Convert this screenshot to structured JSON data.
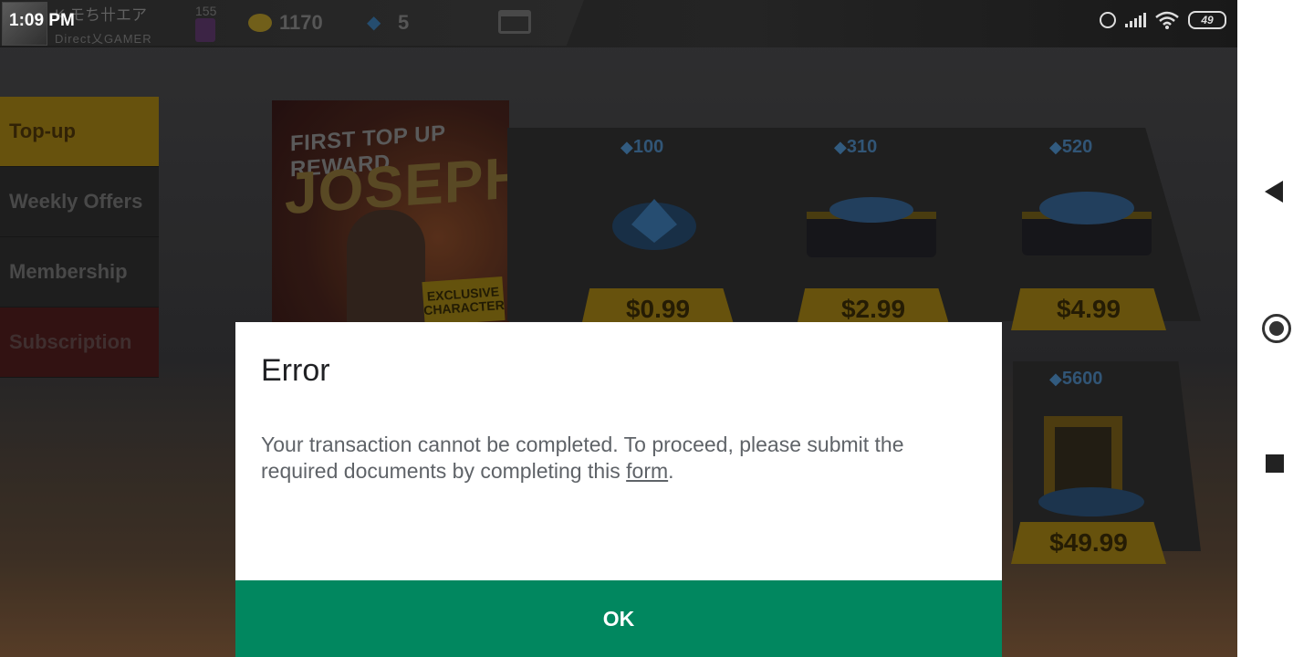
{
  "status_bar": {
    "time": "1:09 PM",
    "battery": "49"
  },
  "topbar": {
    "player_name": "K モち卄エア",
    "player_tag": "Direct乂GAMER",
    "level": "155",
    "coins": "1170",
    "diamonds": "5"
  },
  "sidebar": {
    "items": [
      {
        "label": "Top-up"
      },
      {
        "label": "Weekly Offers"
      },
      {
        "label": "Membership"
      },
      {
        "label": "Subscription"
      }
    ]
  },
  "banner": {
    "small": "FIRST TOP UP REWARD",
    "big": "JOSEPH",
    "tag": "EXCLUSIVE CHARACTER"
  },
  "packs": [
    {
      "amount": "100",
      "price": "$0.99"
    },
    {
      "amount": "310",
      "price": "$2.99"
    },
    {
      "amount": "520",
      "price": "$4.99"
    },
    {
      "amount": "5600",
      "price": "$49.99"
    }
  ],
  "dialog": {
    "title": "Error",
    "body_before": "Your transaction cannot be completed. To proceed, please submit the required documents by completing this ",
    "link": "form",
    "body_after": ".",
    "button": "OK"
  },
  "colors": {
    "accent": "#01875f",
    "active_tab": "#7e6410",
    "dialog_text": "#5f6368"
  }
}
